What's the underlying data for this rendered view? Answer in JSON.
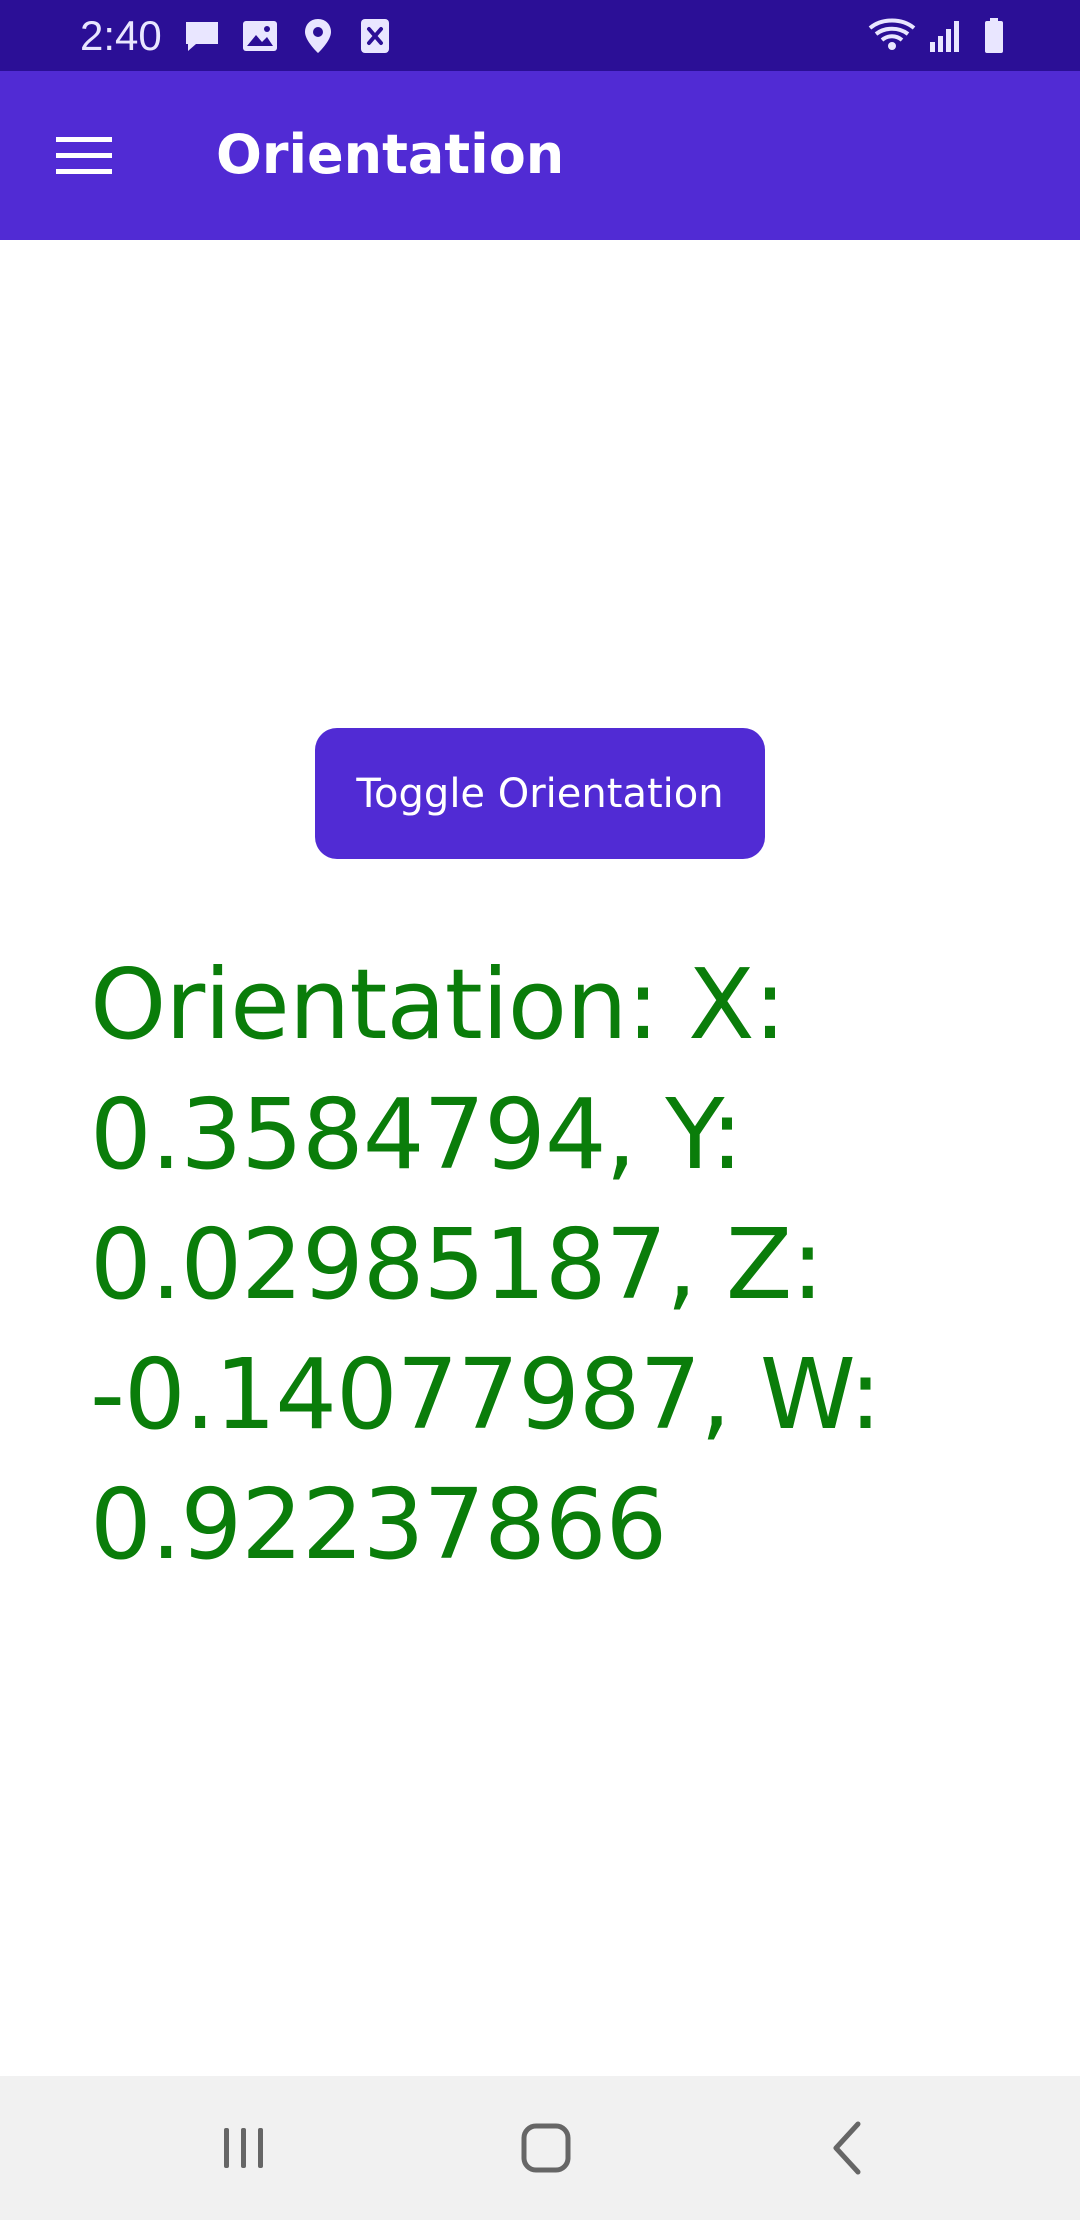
{
  "status_bar": {
    "time": "2:40",
    "icons_left": [
      "message-icon",
      "image-icon",
      "location-icon",
      "close-box-icon"
    ],
    "icons_right": [
      "wifi-icon",
      "signal-icon",
      "battery-icon"
    ]
  },
  "app_bar": {
    "menu_icon": "hamburger-menu-icon",
    "title": "Orientation"
  },
  "main": {
    "toggle_button_label": "Toggle Orientation",
    "orientation_lines": [
      "Orientation: X:",
      "0.3584794, Y:",
      "0.02985187, Z:",
      "-0.14077987, W:",
      "0.92237866"
    ]
  },
  "nav_bar": {
    "buttons": [
      "recent-apps-icon",
      "home-icon",
      "back-icon"
    ]
  },
  "colors": {
    "status_bar": "#2b0f96",
    "app_bar": "#512bd4",
    "button": "#512bd4",
    "orientation_text": "#0a7d0a",
    "nav_bar": "#f1f1f1"
  }
}
